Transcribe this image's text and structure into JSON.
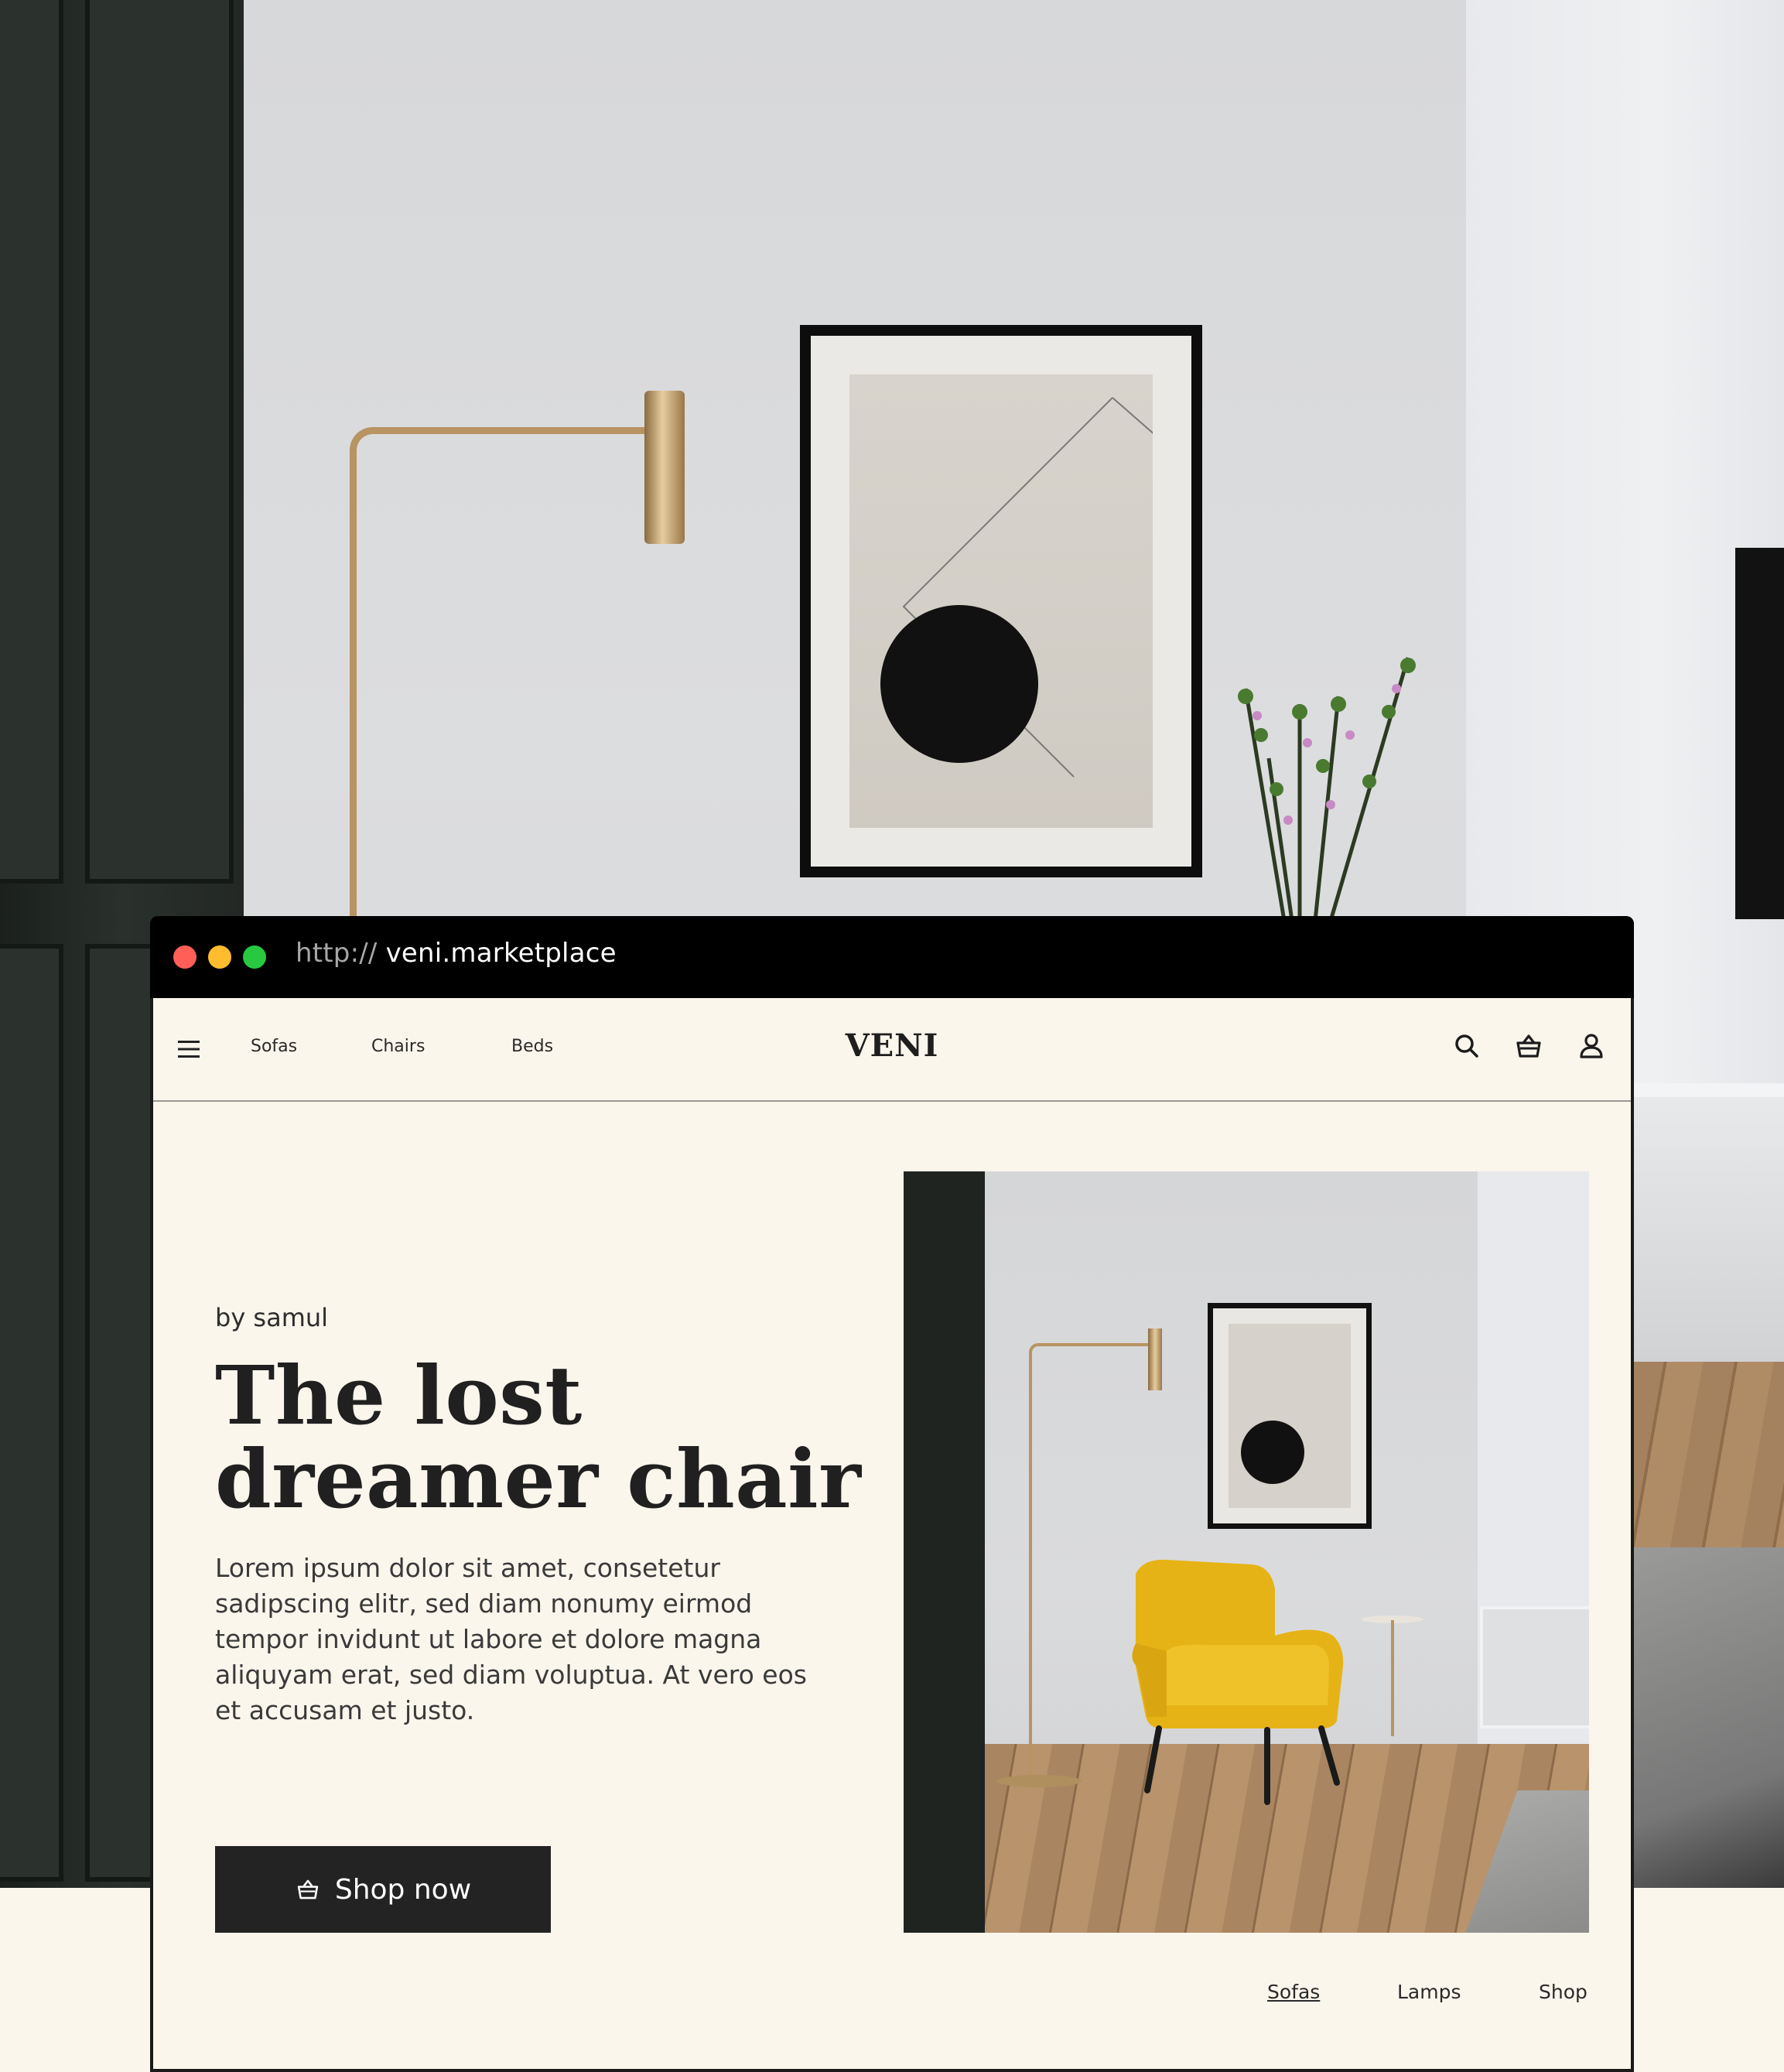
{
  "browser": {
    "url_protocol": "http://",
    "url_host": "veni.marketplace",
    "traffic_lights": [
      "#ff5f57",
      "#febc2e",
      "#28c840"
    ]
  },
  "nav": {
    "links": [
      "Sofas",
      "Chairs",
      "Beds"
    ],
    "logo": "VENI",
    "icons": [
      "search-icon",
      "basket-icon",
      "user-icon"
    ]
  },
  "hero": {
    "byline": "by samul",
    "headline_line1": "The lost",
    "headline_line2": "dreamer chair",
    "body": "Lorem ipsum dolor sit amet, consetetur sadipscing elitr, sed diam nonumy eirmod tempor invidunt ut labore et dolore magna aliquyam erat, sed diam voluptua. At vero eos et accusam et justo.",
    "cta_label": "Shop now",
    "cta_icon": "basket-icon"
  },
  "footer_links": [
    "Sofas",
    "Lamps",
    "Shop"
  ],
  "colors": {
    "page_bg": "#fbf6ec",
    "text": "#202020",
    "button_bg": "#232323",
    "chair_yellow": "#e8b618"
  }
}
